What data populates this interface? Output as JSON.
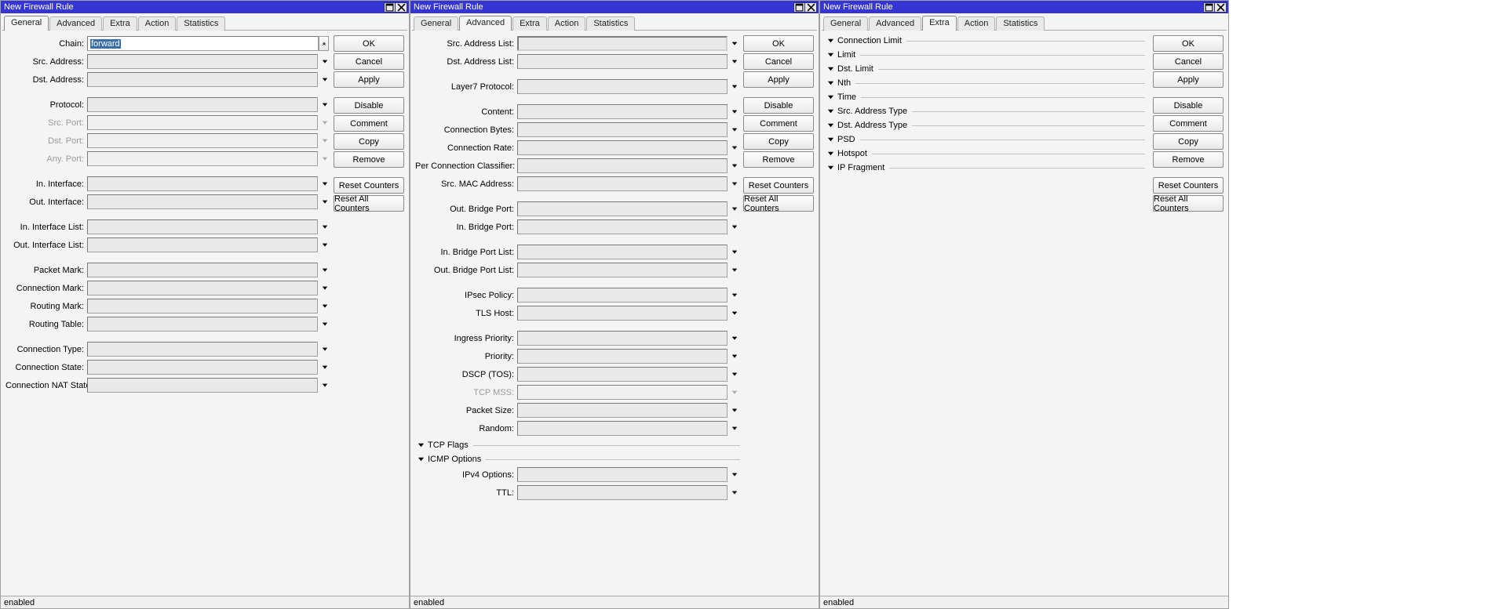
{
  "windows": [
    {
      "title": "New Firewall Rule",
      "status": "enabled",
      "active_tab": "General"
    },
    {
      "title": "New Firewall Rule",
      "status": "enabled",
      "active_tab": "Advanced"
    },
    {
      "title": "New Firewall Rule",
      "status": "enabled",
      "active_tab": "Extra"
    }
  ],
  "tabs": [
    "General",
    "Advanced",
    "Extra",
    "Action",
    "Statistics"
  ],
  "buttons": {
    "ok": "OK",
    "cancel": "Cancel",
    "apply": "Apply",
    "disable": "Disable",
    "comment": "Comment",
    "copy": "Copy",
    "remove": "Remove",
    "reset_counters": "Reset Counters",
    "reset_all_counters": "Reset All Counters"
  },
  "general": {
    "chain_label": "Chain:",
    "chain_value": "forward",
    "src_address": "Src. Address:",
    "dst_address": "Dst. Address:",
    "protocol": "Protocol:",
    "src_port": "Src. Port:",
    "dst_port": "Dst. Port:",
    "any_port": "Any. Port:",
    "in_interface": "In. Interface:",
    "out_interface": "Out. Interface:",
    "in_interface_list": "In. Interface List:",
    "out_interface_list": "Out. Interface List:",
    "packet_mark": "Packet Mark:",
    "connection_mark": "Connection Mark:",
    "routing_mark": "Routing Mark:",
    "routing_table": "Routing Table:",
    "connection_type": "Connection Type:",
    "connection_state": "Connection State:",
    "connection_nat_state": "Connection NAT State:"
  },
  "advanced": {
    "src_address_list": "Src. Address List:",
    "dst_address_list": "Dst. Address List:",
    "layer7_protocol": "Layer7 Protocol:",
    "content": "Content:",
    "connection_bytes": "Connection Bytes:",
    "connection_rate": "Connection Rate:",
    "per_connection_classifier": "Per Connection Classifier:",
    "src_mac_address": "Src. MAC Address:",
    "out_bridge_port": "Out. Bridge Port:",
    "in_bridge_port": "In. Bridge Port:",
    "in_bridge_port_list": "In. Bridge Port List:",
    "out_bridge_port_list": "Out. Bridge Port List:",
    "ipsec_policy": "IPsec Policy:",
    "tls_host": "TLS Host:",
    "ingress_priority": "Ingress Priority:",
    "priority": "Priority:",
    "dscp_tos": "DSCP (TOS):",
    "tcp_mss": "TCP MSS:",
    "packet_size": "Packet Size:",
    "random": "Random:",
    "tcp_flags": "TCP Flags",
    "icmp_options": "ICMP Options",
    "ipv4_options": "IPv4 Options:",
    "ttl": "TTL:"
  },
  "extra": {
    "connection_limit": "Connection Limit",
    "limit": "Limit",
    "dst_limit": "Dst. Limit",
    "nth": "Nth",
    "time": "Time",
    "src_address_type": "Src. Address Type",
    "dst_address_type": "Dst. Address Type",
    "psd": "PSD",
    "hotspot": "Hotspot",
    "ip_fragment": "IP Fragment"
  }
}
